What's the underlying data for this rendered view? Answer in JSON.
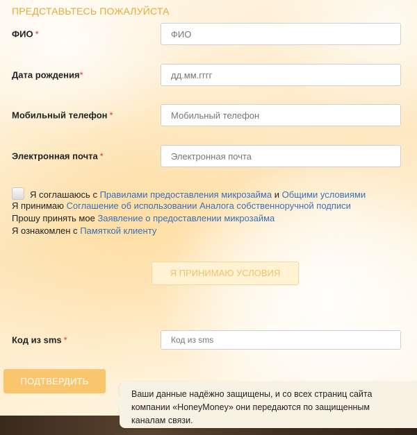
{
  "form": {
    "section_title": "ПРЕДСТАВЬТЕСЬ ПОЖАЛУЙСТА",
    "required_mark": "*",
    "fields": [
      {
        "label": "ФИО",
        "placeholder": "ФИО",
        "value": ""
      },
      {
        "label": "Дата рождения",
        "placeholder": "дд.мм.гггг",
        "value": ""
      },
      {
        "label": "Мобильный телефон",
        "placeholder": "Мобильный телефон",
        "value": ""
      },
      {
        "label": "Электронная почта",
        "placeholder": "Электронная почта",
        "value": ""
      }
    ],
    "agreement": {
      "checked": false,
      "line1": {
        "prefix": "Я соглашаюсь с ",
        "link1": "Правилами предоставления микрозайма",
        "middle": " и ",
        "link2": "Общими условиями"
      },
      "line2": {
        "prefix": "Я принимаю ",
        "link": "Соглашение об использовании Аналога собственноручной подписи"
      },
      "line3": {
        "prefix": "Прошу принять мое ",
        "link": "Заявление о предоставлении микрозайма"
      },
      "line4": {
        "prefix": "Я ознакомлен с ",
        "link": "Памяткой клиенту"
      }
    },
    "accept_button": "Я ПРИНИМАЮ УСЛОВИЯ",
    "sms": {
      "label": "Код из sms",
      "placeholder": "Код из sms",
      "value": ""
    },
    "confirm_button": "ПОДТВЕРДИТЬ"
  },
  "tooltip": {
    "line1": "Ваши данные надёжно защищены, и со всех страниц сайта",
    "line2": "компании «HoneyMoney» они передаются по защищенным",
    "line3": "каналам связи."
  },
  "colors": {
    "accent": "#e8a93a",
    "confirm_button_bg": "#f9c66d",
    "link": "#3b6fb6",
    "required": "#e03a3a"
  }
}
